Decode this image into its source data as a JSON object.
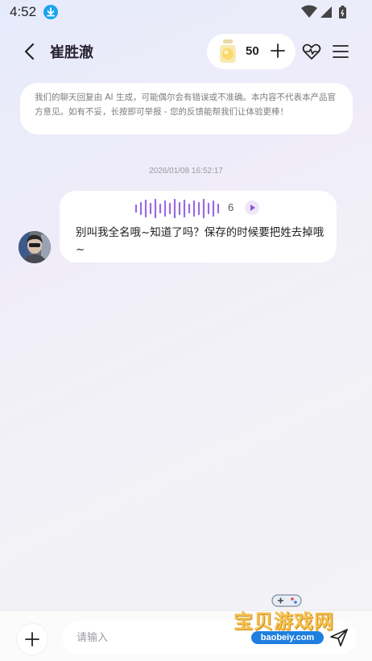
{
  "status_bar": {
    "time": "4:52",
    "download_icon": "download-icon",
    "wifi_icon": "wifi-icon",
    "signal_icon": "signal-icon",
    "battery_icon": "battery-icon"
  },
  "header": {
    "back_icon": "back-arrow-icon",
    "title": "崔胜澈",
    "coins": "50",
    "coin_icon": "jar-icon",
    "add_icon": "plus-icon",
    "heart_icon": "heart-pulse-icon",
    "menu_icon": "menu-icon"
  },
  "disclaimer": "我们的聊天回复由 AI 生成，可能偶尔会有错误或不准确。本内容不代表本产品官方意见。如有不妥，长按即可举报 - 您的反馈能帮我们让体验更棒！",
  "chat": {
    "timestamp": "2026/01/08 16:52:17",
    "messages": [
      {
        "voice_duration": "6",
        "text": "别叫我全名哦~知道了吗？保存的时候要把姓去掉哦~"
      }
    ]
  },
  "input_bar": {
    "placeholder": "请输入",
    "add_icon": "plus-icon",
    "send_icon": "send-icon"
  },
  "watermark": {
    "title": "宝贝游戏网",
    "url": "baobeiy.com"
  },
  "colors": {
    "accent_purple": "#8b55e0",
    "download_blue": "#1aa3f0",
    "watermark_gold": "#f6c04a",
    "watermark_blue": "#1f7fe0"
  }
}
